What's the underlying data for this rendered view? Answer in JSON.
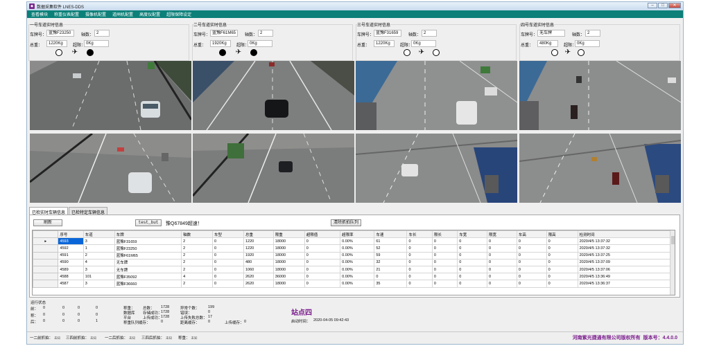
{
  "window": {
    "title": "数据采集软件 LNES-DDS",
    "icon": "app-icon",
    "controls": {
      "minimize": "–",
      "maximize": "□",
      "close": "✕"
    }
  },
  "menu": [
    "查看模块",
    "称重仪表配置",
    "摄像机配置",
    "道闸机配置",
    "高度仪配置",
    "超限保障设定"
  ],
  "labels": {
    "plate": "车牌号：",
    "axles": "轴数：",
    "weight": "总重：",
    "overload": "超限："
  },
  "panels": [
    {
      "title": "一号车道实时信息",
      "plate": "蓝豫F23250",
      "axles": "2",
      "weight": "1220Kg",
      "overload": "0Kg",
      "indicators": [
        "empty",
        "plane",
        "full"
      ]
    },
    {
      "title": "二号车道实时信息",
      "plate": "蓝豫F61M65",
      "axles": "2",
      "weight": "1920Kg",
      "overload": "0Kg",
      "indicators": [
        "full",
        "plane",
        "full"
      ]
    },
    {
      "title": "三号车道实时信息",
      "plate": "蓝豫F31659",
      "axles": "2",
      "weight": "1220Kg",
      "overload": "0Kg",
      "indicators": [
        "empty",
        "plane",
        "empty"
      ]
    },
    {
      "title": "四号车道实时信息",
      "plate": "无车牌",
      "axles": "2",
      "weight": "480Kg",
      "overload": "0Kg",
      "indicators": [
        "empty",
        "plane",
        "empty"
      ]
    }
  ],
  "tabs": [
    "已检实时车辆信息",
    "已检特定车辆信息"
  ],
  "toolbar": {
    "refresh": "刷新",
    "test": "test_but",
    "ticker": "豫Q67849超速！",
    "clear_queue": "清除抓拍队列"
  },
  "table": {
    "columns": [
      "序号",
      "车道",
      "车牌",
      "轴数",
      "车型",
      "总重",
      "限重",
      "超限值",
      "超限率",
      "车速",
      "车长",
      "限长",
      "车宽",
      "限宽",
      "车高",
      "限高",
      "检测时间"
    ],
    "rows": [
      [
        "4593",
        "3",
        "蓝豫F31659",
        "2",
        "0",
        "1220",
        "18000",
        "0",
        "0.00%",
        "61",
        "0",
        "0",
        "0",
        "0",
        "0",
        "0",
        "2020/4/5 13:37:32"
      ],
      [
        "4592",
        "1",
        "蓝豫F23250",
        "2",
        "0",
        "1220",
        "18000",
        "0",
        "0.00%",
        "52",
        "0",
        "0",
        "0",
        "0",
        "0",
        "0",
        "2020/4/5 13:37:32"
      ],
      [
        "4591",
        "2",
        "蓝豫F61M65",
        "2",
        "0",
        "1920",
        "18000",
        "0",
        "0.00%",
        "59",
        "0",
        "0",
        "0",
        "0",
        "0",
        "0",
        "2020/4/5 13:37:25"
      ],
      [
        "4590",
        "4",
        "无车牌",
        "2",
        "0",
        "480",
        "18000",
        "0",
        "0.00%",
        "32",
        "0",
        "0",
        "0",
        "0",
        "0",
        "0",
        "2020/4/5 13:37:09"
      ],
      [
        "4589",
        "3",
        "无车牌",
        "2",
        "0",
        "1060",
        "18000",
        "0",
        "0.00%",
        "21",
        "0",
        "0",
        "0",
        "0",
        "0",
        "0",
        "2020/4/5 13:37:06"
      ],
      [
        "4588",
        "101",
        "蓝豫F35092",
        "4",
        "0",
        "2620",
        "36000",
        "0",
        "0.00%",
        "0",
        "0",
        "0",
        "0",
        "0",
        "0",
        "0",
        "2020/4/5 13:36:49"
      ],
      [
        "4587",
        "3",
        "蓝豫F36660",
        "2",
        "0",
        "2620",
        "18000",
        "0",
        "0.00%",
        "35",
        "0",
        "0",
        "0",
        "0",
        "0",
        "0",
        "2020/4/5 13:36:37"
      ]
    ],
    "selected_row_marker": "▸"
  },
  "status": {
    "title": "运行状态",
    "rows": [
      {
        "label": "前：",
        "values": [
          "0",
          "0",
          "0",
          "0"
        ]
      },
      {
        "label": "称：",
        "values": [
          "0",
          "0",
          "0",
          "0"
        ]
      },
      {
        "label": "后：",
        "values": [
          "0",
          "0",
          "0",
          "1"
        ]
      }
    ],
    "mid_labels": [
      "称重：",
      "数据库",
      "平台",
      "称重队列缓存："
    ],
    "total_label": "总数：",
    "total": "1728",
    "save_label": "存储成功：",
    "save": "1728",
    "upload_label": "上传成功：",
    "upload": "1728",
    "cache": "0",
    "exception_label": "异常个数：",
    "exception": "199",
    "error_label": "错误：",
    "error": "0",
    "upload_fail_label": "上传失败总数：",
    "upload_fail": "17",
    "dist_label": "距离缓存：",
    "dist": "0",
    "upload_cache_label": "上传缓存：",
    "upload_cache": "0",
    "station": "站点四",
    "start_label": "启动时间：",
    "start_time": "2020-04-05 09:42:43"
  },
  "bottom": {
    "items": [
      {
        "label": "一二前抓拍：",
        "value": "未知"
      },
      {
        "label": "三四前抓拍：",
        "value": "未知"
      },
      {
        "label": "一二后抓拍：",
        "value": "未知"
      },
      {
        "label": "三四后抓拍：",
        "value": "未知"
      },
      {
        "label": "称重：",
        "value": "未知"
      }
    ],
    "copyright": "河南紫光捷通有限公司版权所有",
    "version": "版本号：4.4.0.0"
  },
  "colors": {
    "menubar": "#0c8079",
    "selection": "#0a66d8",
    "brand_purple": "#7a1b8c"
  }
}
